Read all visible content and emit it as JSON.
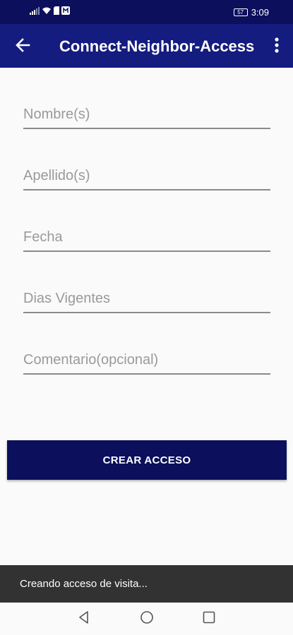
{
  "status_bar": {
    "time": "3:09",
    "battery_level": "57",
    "icons": [
      "signal-icon",
      "wifi-icon",
      "sim-icon",
      "notification-icon"
    ]
  },
  "app_bar": {
    "title": "Connect-Neighbor-Access",
    "back_icon": "arrow-left-icon",
    "menu_icon": "more-vert-icon",
    "background_color": "#141c80"
  },
  "form": {
    "fields": [
      {
        "placeholder": "Nombre(s)",
        "value": ""
      },
      {
        "placeholder": "Apellido(s)",
        "value": ""
      },
      {
        "placeholder": "Fecha",
        "value": ""
      },
      {
        "placeholder": "Dias Vigentes",
        "value": ""
      },
      {
        "placeholder": "Comentario(opcional)",
        "value": ""
      }
    ],
    "submit_label": "CREAR ACCESO",
    "submit_color": "#0b0f5c"
  },
  "snackbar": {
    "message": "Creando acceso de visita..."
  },
  "nav_bar": {
    "buttons": [
      "back-triangle-icon",
      "home-circle-icon",
      "recents-square-icon"
    ]
  }
}
